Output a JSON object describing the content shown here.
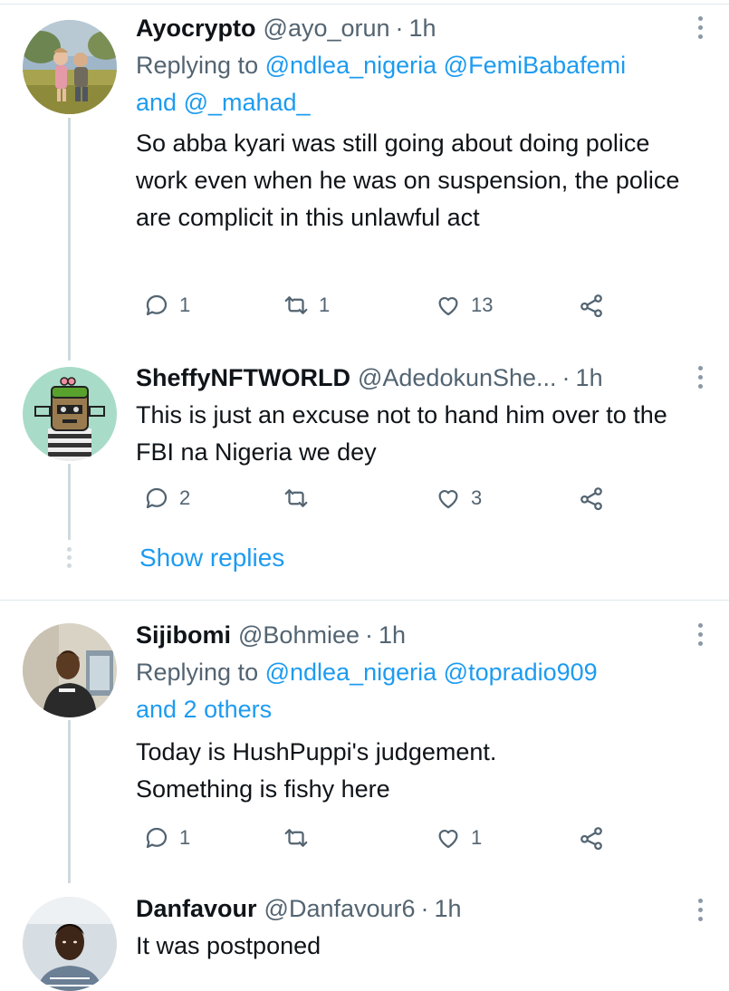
{
  "tweets": [
    {
      "name": "Ayocrypto",
      "handle": "@ayo_orun",
      "dot": "·",
      "time": "1h",
      "replying_label": "Replying to",
      "replying_mention1": "@ndlea_nigeria",
      "replying_mention2": "@FemiBabafemi",
      "replying_and": "and",
      "replying_mention3": "@_mahad_",
      "text": "So abba kyari was still going about doing police work even when he was on suspension, the police are complicit in this unlawful act",
      "reply_count": "1",
      "retweet_count": "1",
      "like_count": "13",
      "avatar_icon": "avatar-two-children-in-field"
    },
    {
      "name": "SheffyNFTWORLD",
      "handle": "@AdedokunShe...",
      "dot": "·",
      "time": "1h",
      "text": "This is just an excuse not to hand him over to the FBI na Nigeria we dey",
      "reply_count": "2",
      "retweet_count": "",
      "like_count": "3",
      "avatar_icon": "avatar-nft-character"
    },
    {
      "name": "Sijibomi",
      "handle": "@Bohmiee",
      "dot": "·",
      "time": "1h",
      "replying_label": "Replying to",
      "replying_mention1": "@ndlea_nigeria",
      "replying_mention2": "@topradio909",
      "replying_others": "and 2 others",
      "text_line1": "Today is HushPuppi's judgement.",
      "text_line2": "Something is fishy here",
      "reply_count": "1",
      "retweet_count": "",
      "like_count": "1",
      "avatar_icon": "avatar-man-photo"
    },
    {
      "name": "Danfavour",
      "handle": "@Danfavour6",
      "dot": "·",
      "time": "1h",
      "text": "It was postponed",
      "avatar_icon": "avatar-young-man-photo"
    }
  ],
  "show_replies": "Show replies",
  "colors": {
    "link": "#1d9bf0",
    "secondary_text": "#536471",
    "primary_text": "#0f1419",
    "divider": "#e1e8ed",
    "thread_line": "#cfd9de"
  }
}
